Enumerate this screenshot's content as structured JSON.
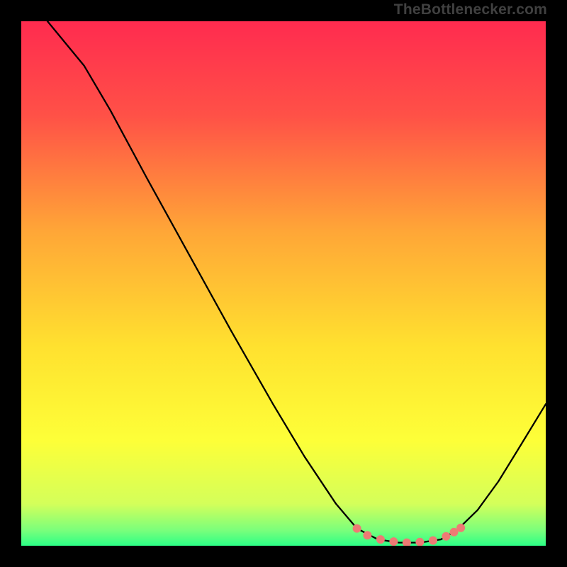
{
  "watermark": "TheBottlenecker.com",
  "chart_data": {
    "type": "line",
    "title": "",
    "xlabel": "",
    "ylabel": "",
    "xlim": [
      0,
      100
    ],
    "ylim": [
      0,
      100
    ],
    "gradient_stops": [
      {
        "offset": 0,
        "color": "#ff2b4f"
      },
      {
        "offset": 18,
        "color": "#ff5147"
      },
      {
        "offset": 40,
        "color": "#ffa637"
      },
      {
        "offset": 62,
        "color": "#ffe12f"
      },
      {
        "offset": 80,
        "color": "#fdff38"
      },
      {
        "offset": 92,
        "color": "#d4ff5a"
      },
      {
        "offset": 97,
        "color": "#7bff7b"
      },
      {
        "offset": 100,
        "color": "#2cff86"
      }
    ],
    "series": [
      {
        "name": "curve",
        "stroke": "#000000",
        "width": 2.3,
        "points": [
          {
            "x": 5,
            "y": 100
          },
          {
            "x": 12,
            "y": 91.5
          },
          {
            "x": 17,
            "y": 83
          },
          {
            "x": 24,
            "y": 70
          },
          {
            "x": 32,
            "y": 55.5
          },
          {
            "x": 40,
            "y": 41
          },
          {
            "x": 48,
            "y": 27
          },
          {
            "x": 54,
            "y": 17
          },
          {
            "x": 60,
            "y": 8
          },
          {
            "x": 64,
            "y": 3.3
          },
          {
            "x": 68,
            "y": 1.2
          },
          {
            "x": 72,
            "y": 0.6
          },
          {
            "x": 76,
            "y": 0.6
          },
          {
            "x": 80,
            "y": 1.2
          },
          {
            "x": 83,
            "y": 2.9
          },
          {
            "x": 87,
            "y": 6.8
          },
          {
            "x": 91,
            "y": 12.3
          },
          {
            "x": 95,
            "y": 18.8
          },
          {
            "x": 100,
            "y": 27
          }
        ]
      }
    ],
    "markers": {
      "color": "#ee7a74",
      "radius": 6,
      "points": [
        {
          "x": 64,
          "y": 3.3
        },
        {
          "x": 66,
          "y": 2.0
        },
        {
          "x": 68.5,
          "y": 1.2
        },
        {
          "x": 71,
          "y": 0.8
        },
        {
          "x": 73.5,
          "y": 0.6
        },
        {
          "x": 76,
          "y": 0.7
        },
        {
          "x": 78.5,
          "y": 1.0
        },
        {
          "x": 81,
          "y": 1.8
        },
        {
          "x": 82.5,
          "y": 2.6
        },
        {
          "x": 83.8,
          "y": 3.4
        }
      ]
    }
  }
}
